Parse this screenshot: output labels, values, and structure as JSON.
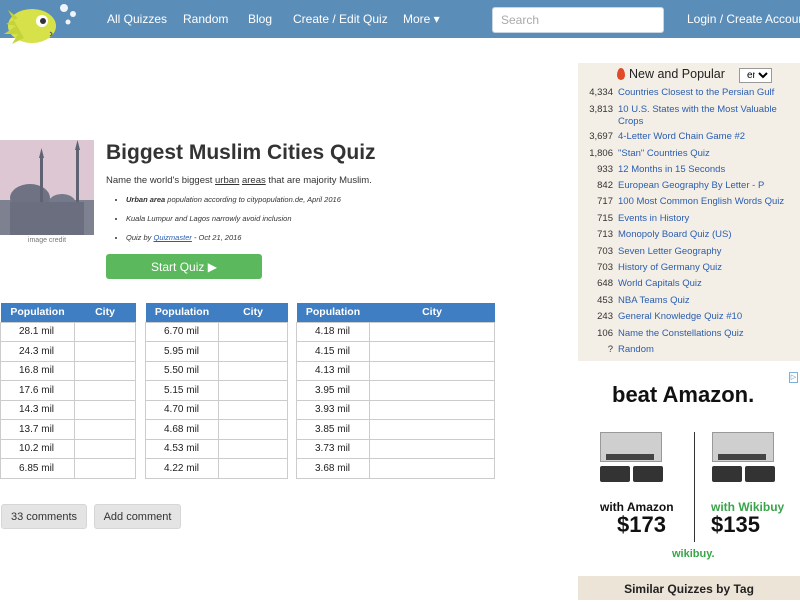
{
  "nav": {
    "items": [
      "All Quizzes",
      "Random",
      "Blog",
      "Create / Edit Quiz",
      "More ▾"
    ],
    "search_placeholder": "Search",
    "login": "Login / Create Account"
  },
  "quiz": {
    "image_credit": "image credit",
    "title": "Biggest Muslim Cities Quiz",
    "desc_pre": "Name the world's biggest ",
    "desc_link1": "urban",
    "desc_link2": "areas",
    "desc_post": " that are majority Muslim.",
    "note1_bold": "Urban area",
    "note1_rest": " population according to citypopulation.de, April 2016",
    "note2": "Kuala Lumpur and Lagos narrowly avoid inclusion",
    "note3_pre": "Quiz by ",
    "note3_author": "Quizmaster",
    "note3_post": " - Oct 21, 2016",
    "start_label": "Start Quiz ▶"
  },
  "tables": {
    "col_population": "Population",
    "col_city": "City",
    "t1": [
      "28.1 mil",
      "24.3 mil",
      "16.8 mil",
      "17.6 mil",
      "14.3 mil",
      "13.7 mil",
      "10.2 mil",
      "6.85 mil"
    ],
    "t2": [
      "6.70 mil",
      "5.95 mil",
      "5.50 mil",
      "5.15 mil",
      "4.70 mil",
      "4.68 mil",
      "4.53 mil",
      "4.22 mil"
    ],
    "t3": [
      "4.18 mil",
      "4.15 mil",
      "4.13 mil",
      "3.95 mil",
      "3.93 mil",
      "3.85 mil",
      "3.73 mil",
      "3.68 mil"
    ]
  },
  "actions": {
    "comments": "33 comments",
    "add_comment": "Add comment"
  },
  "sidebar": {
    "heading": "New and Popular",
    "lang": "en",
    "items": [
      {
        "count": "4,334",
        "label": "Countries Closest to the Persian Gulf"
      },
      {
        "count": "3,813",
        "label": "10 U.S. States with the Most Valuable Crops"
      },
      {
        "count": "3,697",
        "label": "4-Letter Word Chain Game #2"
      },
      {
        "count": "1,806",
        "label": "\"Stan\" Countries Quiz"
      },
      {
        "count": "933",
        "label": "12 Months in 15 Seconds"
      },
      {
        "count": "842",
        "label": "European Geography By Letter - P"
      },
      {
        "count": "717",
        "label": "100 Most Common English Words Quiz"
      },
      {
        "count": "715",
        "label": "Events in History"
      },
      {
        "count": "713",
        "label": "Monopoly Board Quiz (US)"
      },
      {
        "count": "703",
        "label": "Seven Letter Geography"
      },
      {
        "count": "703",
        "label": "History of Germany Quiz"
      },
      {
        "count": "648",
        "label": "World Capitals Quiz"
      },
      {
        "count": "453",
        "label": "NBA Teams Quiz"
      },
      {
        "count": "243",
        "label": "General Knowledge Quiz #10"
      },
      {
        "count": "106",
        "label": "Name the Constellations Quiz"
      },
      {
        "count": "?",
        "label": "Random"
      }
    ],
    "similar": "Similar Quizzes by Tag"
  },
  "ad": {
    "title": "beat Amazon.",
    "left_label": "with Amazon",
    "left_price": "$173",
    "right_label": "with Wikibuy",
    "right_price": "$135",
    "brand": "wikibuy.",
    "badge": "▷"
  },
  "colors": {
    "topbar": "#5b8db9",
    "table_header": "#3f7ec2",
    "start_button": "#5cb85c",
    "link": "#2a5db0",
    "wikibuy_green": "#3aa54a"
  }
}
